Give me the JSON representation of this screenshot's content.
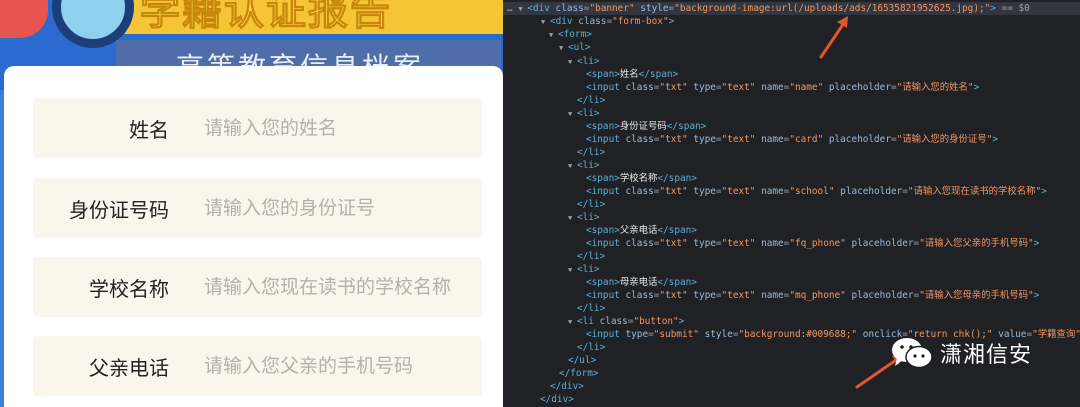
{
  "banner": {
    "title": "学籍认证报告",
    "subtitle": "高等教育信息档案"
  },
  "form": {
    "fields": [
      {
        "label": "姓名",
        "placeholder": "请输入您的姓名"
      },
      {
        "label": "身份证号码",
        "placeholder": "请输入您的身份证号"
      },
      {
        "label": "学校名称",
        "placeholder": "请输入您现在读书的学校名称"
      },
      {
        "label": "父亲电话",
        "placeholder": "请输入您父亲的手机号码"
      }
    ]
  },
  "devtools": {
    "l0": {
      "class": "banner",
      "style": "background-image:url(/uploads/ads/16535821952625.jpg);",
      "suffix": "== $0"
    },
    "l1": {
      "class": "form-box"
    },
    "li1": {
      "span": "姓名",
      "class": "txt",
      "type": "text",
      "name": "name",
      "placeholder": "请输入您的姓名"
    },
    "li2": {
      "span": "身份证号码",
      "class": "txt",
      "type": "text",
      "name": "card",
      "placeholder": "请输入您的身份证号"
    },
    "li3": {
      "span": "学校名称",
      "class": "txt",
      "type": "text",
      "name": "school",
      "placeholder": "请输入您现在读书的学校名称"
    },
    "li4": {
      "span": "父亲电话",
      "class": "txt",
      "type": "text",
      "name": "fq_phone",
      "placeholder": "请输入您父亲的手机号码"
    },
    "li5": {
      "span": "母亲电话",
      "class": "txt",
      "type": "text",
      "name": "mq_phone",
      "placeholder": "请输入您母亲的手机号码"
    },
    "li6": {
      "class": "button",
      "type": "submit",
      "style": "background:#009688;",
      "onclick": "return chk();",
      "value": "学籍查询"
    }
  },
  "watermark": {
    "text": "潇湘信安"
  },
  "colors": {
    "arrow": "#e2562d",
    "highlight_row": "#323641"
  }
}
